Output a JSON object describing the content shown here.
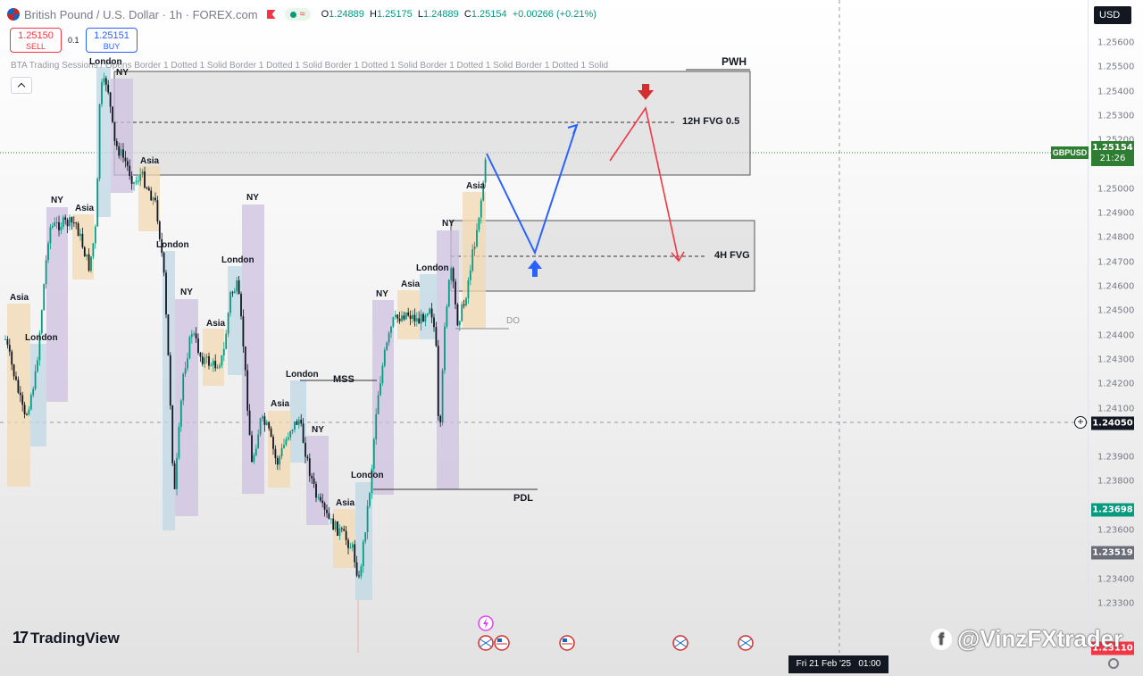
{
  "header": {
    "symbol_title": "British Pound / U.S. Dollar · 1h · FOREX.com",
    "ohlc": {
      "o_label": "O",
      "o": "1.24889",
      "h_label": "H",
      "h": "1.25175",
      "l_label": "L",
      "l": "1.24889",
      "c_label": "C",
      "c": "1.25154",
      "change": "+0.00266 (+0.21%)"
    }
  },
  "trade": {
    "sell_price": "1.25150",
    "sell_label": "SELL",
    "spread": "0.1",
    "buy_price": "1.25151",
    "buy_label": "BUY"
  },
  "indicator": {
    "name": "BTA Trading Sessions / Opens Border 1 Dotted 1 Solid Border 1 Dotted 1 Solid Border 1 Dotted 1 Solid Border 1 Dotted 1 Solid Border 1 Dotted 1 Solid"
  },
  "currency": "USD",
  "price_axis": {
    "ticks": [
      "1.25600",
      "1.25500",
      "1.25400",
      "1.25300",
      "1.25200",
      "1.25000",
      "1.24900",
      "1.24800",
      "1.24700",
      "1.24600",
      "1.24500",
      "1.24400",
      "1.24300",
      "1.24200",
      "1.24100",
      "1.23900",
      "1.23800",
      "1.23600",
      "1.23400",
      "1.23300"
    ],
    "current": {
      "symbol": "GBPUSD",
      "price": "1.25154",
      "countdown": "21:26",
      "color": "#2e7d32"
    },
    "crosshair_price": "1.24050",
    "label_green": "1.23698",
    "label_gray": "1.23519",
    "label_red": "1.23110"
  },
  "annotations": {
    "pwh": "PWH",
    "fvg12": "12H FVG 0.5",
    "fvg4": "4H FVG",
    "mss": "MSS",
    "pdl": "PDL",
    "do": "DO"
  },
  "sessions": {
    "asia": "Asia",
    "london": "London",
    "ny": "NY"
  },
  "time_axis": {
    "crosshair_time": "Fri 21 Feb '25   01:00"
  },
  "branding": {
    "logo_text": "TradingView",
    "watermark": "@VinzFXtrader"
  },
  "colors": {
    "up": "#089981",
    "down": "#131722",
    "blue_path": "#2962ff",
    "red_path": "#f23645",
    "blue_arrow": "#2962ff",
    "red_arrow": "#d32f2f"
  }
}
